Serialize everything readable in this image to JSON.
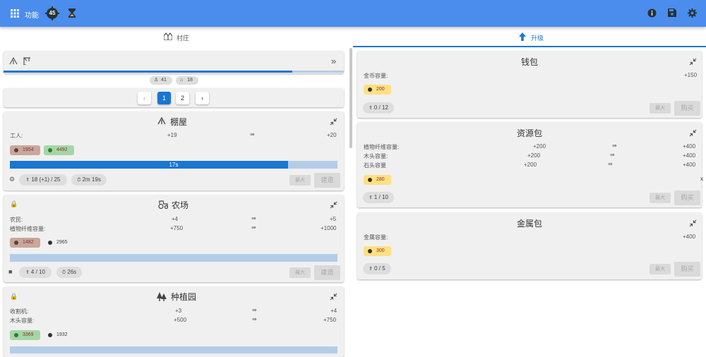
{
  "appbar": {
    "title": "功能",
    "badge": "45",
    "icons": [
      "grid-icon",
      "cog-badge-icon",
      "hourglass-icon",
      "info-icon",
      "save-icon",
      "settings-icon"
    ]
  },
  "tabs": [
    {
      "label": "村庄",
      "icon": "village-icon"
    },
    {
      "label": "升级",
      "icon": "arrow-up-icon"
    }
  ],
  "toolbar": {
    "stats": [
      {
        "icon": "worker-icon",
        "value": "41"
      },
      {
        "icon": "home-icon",
        "value": "18"
      }
    ],
    "pages": [
      "1",
      "2"
    ],
    "nav_prev": "‹",
    "nav_next": "›",
    "expand": "»"
  },
  "buildings": [
    {
      "name": "棚屋",
      "rows": [
        {
          "label": "工人:",
          "from": "+19",
          "to": "+20"
        }
      ],
      "costs": [
        {
          "value": "1954"
        },
        {
          "value": "4492"
        }
      ],
      "progress": {
        "label": "17s",
        "fraction": 0.85
      },
      "level": "18 (+1) / 25",
      "time": "2m 19s",
      "btn_max": "最大",
      "btn_build": "建造"
    },
    {
      "name": "农场",
      "rows": [
        {
          "label": "农民:",
          "from": "+4",
          "to": "+5"
        },
        {
          "label": "植物纤维容量:",
          "from": "+750",
          "to": "+1000"
        }
      ],
      "costs": [
        {
          "value": "1482"
        },
        {
          "value": "2965"
        }
      ],
      "level": "4 / 10",
      "time": "26s",
      "btn_max": "最大",
      "btn_build": "建造"
    },
    {
      "name": "种植园",
      "rows": [
        {
          "label": "收割机:",
          "from": "+3",
          "to": "+4"
        },
        {
          "label": "木头容量:",
          "from": "+500",
          "to": "+750"
        }
      ],
      "costs": [
        {
          "value": "3369"
        },
        {
          "value": "1932"
        }
      ]
    }
  ],
  "upgrades": [
    {
      "name": "钱包",
      "rows": [
        {
          "label": "金币容量:",
          "from": "",
          "to": "+150"
        }
      ],
      "cost": "200",
      "level": "0 / 12",
      "btn_max": "最大",
      "btn_buy": "购买"
    },
    {
      "name": "资源包",
      "rows": [
        {
          "label": "植物纤维容量:",
          "from": "+200",
          "to": "+400"
        },
        {
          "label": "木头容量:",
          "from": "+200",
          "to": "+400"
        },
        {
          "label": "石头容量",
          "from": "+200",
          "to": "+400"
        }
      ],
      "cost": "280",
      "level": "1 / 10",
      "btn_max": "最大",
      "btn_buy": "购买"
    },
    {
      "name": "金属包",
      "rows": [
        {
          "label": "金属容量:",
          "from": "",
          "to": "+400"
        }
      ],
      "cost": "300",
      "level": "0 / 5",
      "btn_max": "最大",
      "btn_buy": "购买"
    }
  ],
  "stray_x": "x",
  "colors": {
    "primary": "#4a8ded",
    "accent": "#1976d2",
    "brown_chip": "#c8a79c",
    "green_chip": "#a5d6a7",
    "gold_chip": "#ffe082"
  }
}
